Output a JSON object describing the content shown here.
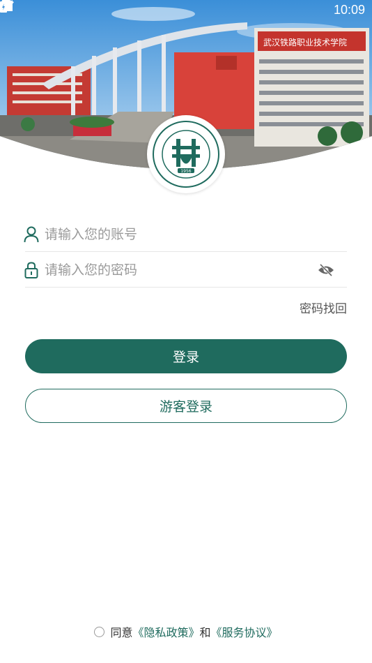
{
  "status_bar": {
    "time": "10:09"
  },
  "banner": {
    "sign_text": "武汉铁路职业技术学院"
  },
  "logo": {
    "year": "1956"
  },
  "form": {
    "account_placeholder": "请输入您的账号",
    "password_placeholder": "请输入您的密码",
    "forgot_label": "密码找回"
  },
  "buttons": {
    "login_label": "登录",
    "guest_label": "游客登录"
  },
  "agreement": {
    "prefix": "同意",
    "privacy_link": "《隐私政策》",
    "and": "和",
    "service_link": "《服务协议》"
  },
  "colors": {
    "accent": "#1f6b5e"
  }
}
